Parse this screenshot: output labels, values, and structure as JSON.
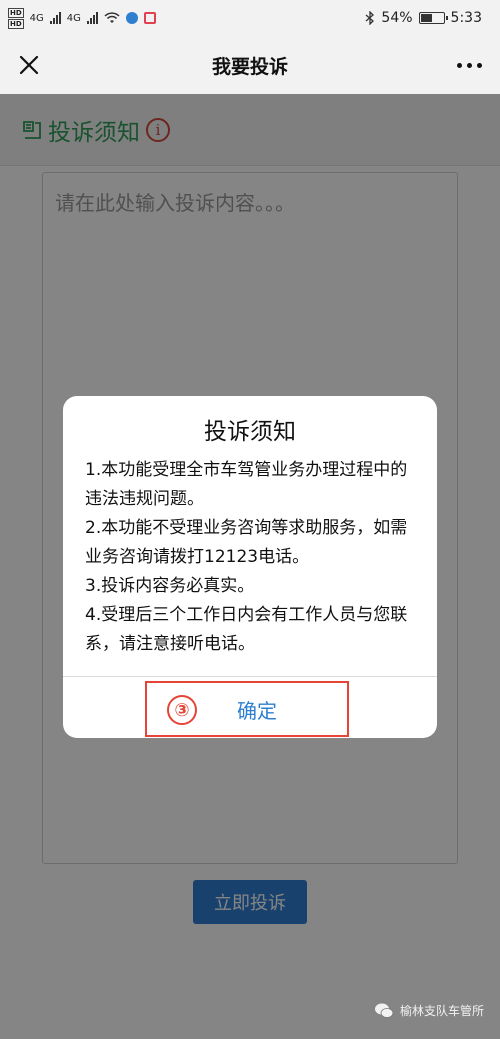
{
  "status_bar": {
    "hd_label": "HD",
    "net_label": "4G",
    "battery_percent": "54%",
    "battery_level": 0.54,
    "time": "5:33"
  },
  "nav": {
    "title": "我要投诉"
  },
  "notice": {
    "title": "投诉须知",
    "info_glyph": "i"
  },
  "form": {
    "placeholder": "请在此处输入投诉内容。。。",
    "submit_label": "立即投诉"
  },
  "dialog": {
    "title": "投诉须知",
    "lines": [
      "1.本功能受理全市车驾管业务办理过程中的违法违规问题。",
      "2.本功能不受理业务咨询等求助服务，如需业务咨询请拨打12123电话。",
      "3.投诉内容务必真实。",
      "4.受理后三个工作日内会有工作人员与您联系，请注意接听电话。"
    ],
    "step_badge": "③",
    "confirm_label": "确定"
  },
  "watermark": {
    "text": "榆林支队车管所"
  },
  "colors": {
    "accent_blue": "#2f7fd1",
    "notice_green": "#2e9d5b",
    "highlight_red": "#e64436"
  }
}
